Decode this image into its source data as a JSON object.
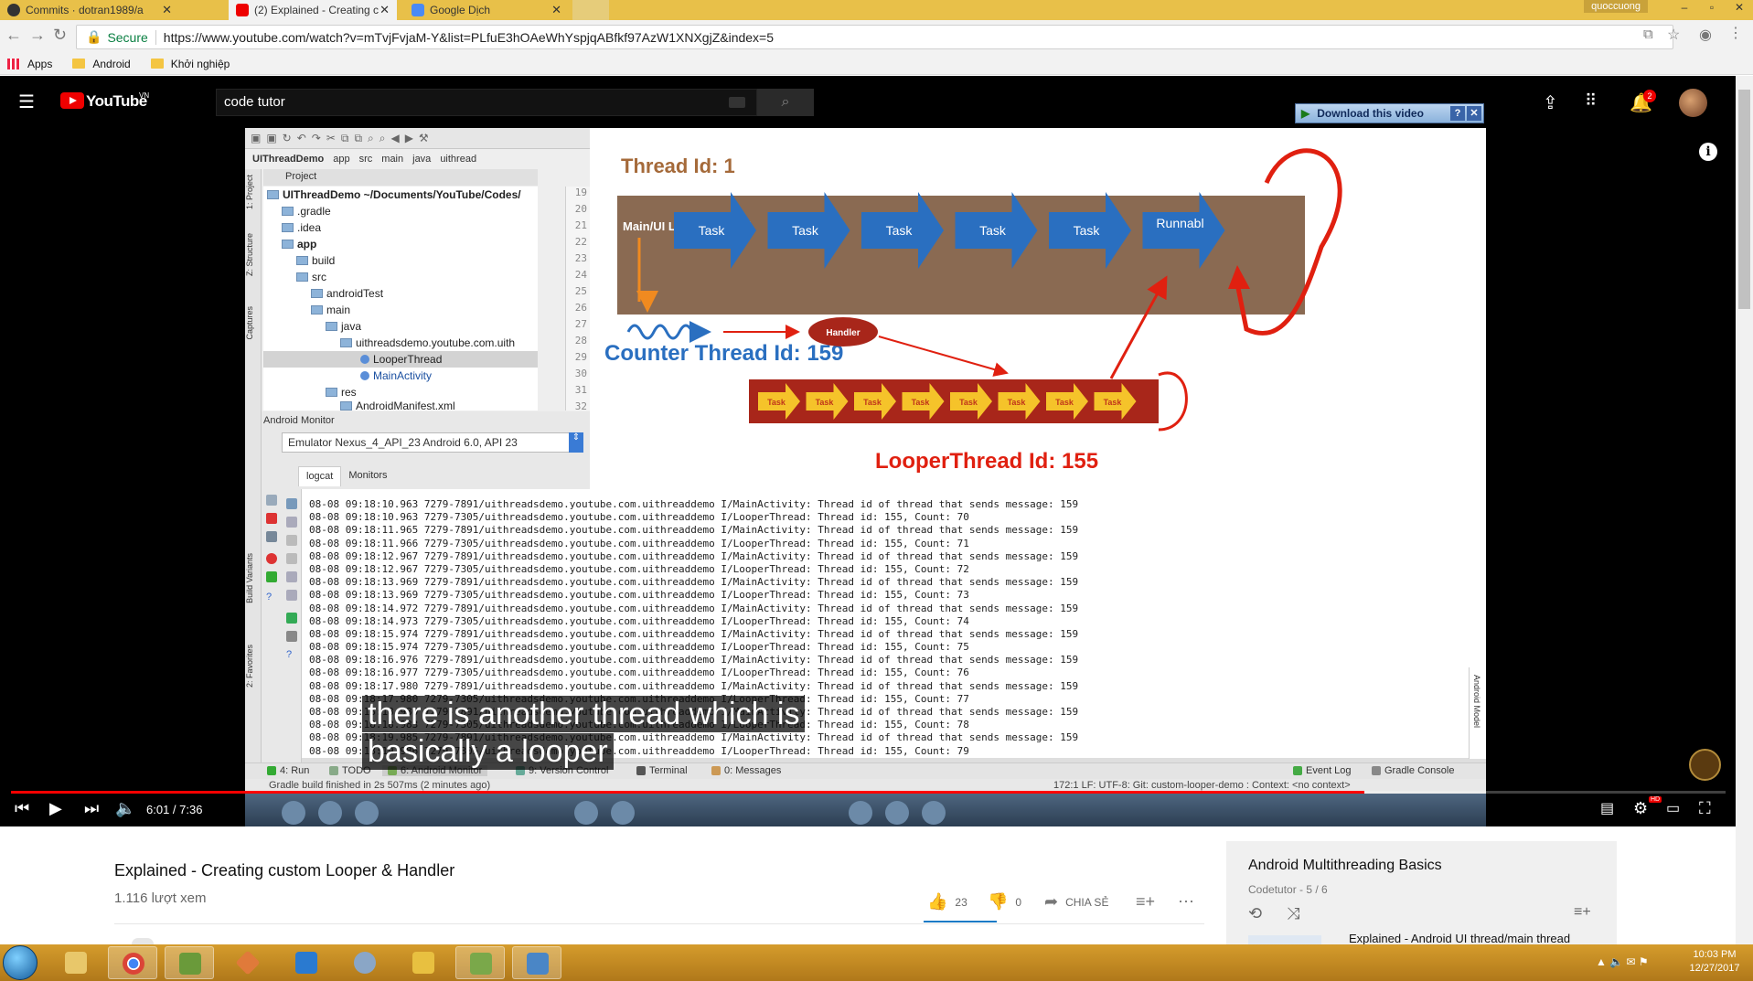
{
  "browser": {
    "tabs": [
      {
        "label": "Commits · dotran1989/a"
      },
      {
        "label": "(2) Explained - Creating c"
      },
      {
        "label": "Google Dịch"
      }
    ],
    "user": "quoccuong",
    "secure_label": "Secure",
    "url": "https://www.youtube.com/watch?v=mTvjFvjaM-Y&list=PLfuE3hOAeWhYspjqABfkf97AzW1XNXgjZ&index=5",
    "bookmarks": [
      "Apps",
      "Android",
      "Khởi nghiệp"
    ]
  },
  "youtube": {
    "logo": "YouTube",
    "region": "VN",
    "search_value": "code tutor",
    "notifications": "2",
    "download_bar": "Download this video"
  },
  "ide": {
    "crumbs": [
      "UIThreadDemo",
      "app",
      "src",
      "main",
      "java",
      "uithread"
    ],
    "project_label": "Project",
    "tree": [
      {
        "label": "UIThreadDemo ~/Documents/YouTube/Codes/",
        "indent": 0
      },
      {
        "label": ".gradle",
        "indent": 1
      },
      {
        "label": ".idea",
        "indent": 1
      },
      {
        "label": "app",
        "indent": 1
      },
      {
        "label": "build",
        "indent": 2
      },
      {
        "label": "src",
        "indent": 2
      },
      {
        "label": "androidTest",
        "indent": 3
      },
      {
        "label": "main",
        "indent": 3
      },
      {
        "label": "java",
        "indent": 4
      },
      {
        "label": "uithreadsdemo.youtube.com.uith",
        "indent": 5
      },
      {
        "label": "LooperThread",
        "indent": 6
      },
      {
        "label": "MainActivity",
        "indent": 6
      },
      {
        "label": "res",
        "indent": 4
      },
      {
        "label": "AndroidManifest.xml",
        "indent": 4
      }
    ],
    "line_numbers": [
      "19",
      "20",
      "21",
      "22",
      "23",
      "24",
      "25",
      "26",
      "27",
      "28",
      "29",
      "30",
      "31",
      "32"
    ],
    "monitor_title": "Android Monitor",
    "emulator": "Emulator Nexus_4_API_23 Android 6.0, API 23",
    "logcat_tab": "logcat",
    "monitors_tab": "Monitors",
    "side_tabs": [
      "1: Project",
      "Z: Structure",
      "Captures",
      "Build Variants",
      "2: Favorites"
    ],
    "right_tab": "Android Model",
    "bottom_tabs": [
      "4: Run",
      "TODO",
      "6: Android Monitor",
      "9: Version Control",
      "Terminal",
      "0: Messages",
      "Event Log",
      "Gradle Console"
    ],
    "status": "Gradle build finished in 2s 507ms (2 minutes ago)",
    "status_right": "172:1   LF:   UTF-8:   Git: custom-looper-demo :   Context: <no context>",
    "log_lines": [
      "08-08 09:18:10.963 7279-7891/uithreadsdemo.youtube.com.uithreaddemo I/MainActivity: Thread id of thread that sends message: 159",
      "08-08 09:18:10.963 7279-7305/uithreadsdemo.youtube.com.uithreaddemo I/LooperThread: Thread id: 155, Count: 70",
      "08-08 09:18:11.965 7279-7891/uithreadsdemo.youtube.com.uithreaddemo I/MainActivity: Thread id of thread that sends message: 159",
      "08-08 09:18:11.966 7279-7305/uithreadsdemo.youtube.com.uithreaddemo I/LooperThread: Thread id: 155, Count: 71",
      "08-08 09:18:12.967 7279-7891/uithreadsdemo.youtube.com.uithreaddemo I/MainActivity: Thread id of thread that sends message: 159",
      "08-08 09:18:12.967 7279-7305/uithreadsdemo.youtube.com.uithreaddemo I/LooperThread: Thread id: 155, Count: 72",
      "08-08 09:18:13.969 7279-7891/uithreadsdemo.youtube.com.uithreaddemo I/MainActivity: Thread id of thread that sends message: 159",
      "08-08 09:18:13.969 7279-7305/uithreadsdemo.youtube.com.uithreaddemo I/LooperThread: Thread id: 155, Count: 73",
      "08-08 09:18:14.972 7279-7891/uithreadsdemo.youtube.com.uithreaddemo I/MainActivity: Thread id of thread that sends message: 159",
      "08-08 09:18:14.973 7279-7305/uithreadsdemo.youtube.com.uithreaddemo I/LooperThread: Thread id: 155, Count: 74",
      "08-08 09:18:15.974 7279-7891/uithreadsdemo.youtube.com.uithreaddemo I/MainActivity: Thread id of thread that sends message: 159",
      "08-08 09:18:15.974 7279-7305/uithreadsdemo.youtube.com.uithreaddemo I/LooperThread: Thread id: 155, Count: 75",
      "08-08 09:18:16.976 7279-7891/uithreadsdemo.youtube.com.uithreaddemo I/MainActivity: Thread id of thread that sends message: 159",
      "08-08 09:18:16.977 7279-7305/uithreadsdemo.youtube.com.uithreaddemo I/LooperThread: Thread id: 155, Count: 76",
      "08-08 09:18:17.980 7279-7891/uithreadsdemo.youtube.com.uithreaddemo I/MainActivity: Thread id of thread that sends message: 159",
      "08-08 09:18:17.980 7279-7305/uithreadsdemo.youtube.com.uithreaddemo I/LooperThread: Thread id: 155, Count: 77",
      "08-08 09:18:18.980 7279-7891/uithreadsdemo.youtube.com.uithreaddemo I/MainActivity: Thread id of thread that sends message: 159",
      "08-08 09:18:18.983 7279-7305/uithreadsdemo.youtube.com.uithreaddemo I/LooperThread: Thread id: 155, Count: 78",
      "08-08 09:18:19.985 7279-7891/uithreadsdemo.youtube.com.uithreaddemo I/MainActivity: Thread id of thread that sends message: 159",
      "08-08 09:18:19.986 7279-7305/uithreadsdemo.youtube.com.uithreaddemo I/LooperThread: Thread id: 155, Count: 79"
    ]
  },
  "slide": {
    "thread_title": "Thread Id: 1",
    "main_label": "Main/UI Looper Thread",
    "tasks": [
      "Task",
      "Task",
      "Task",
      "Task",
      "Task",
      "Runnabl"
    ],
    "counter_label": "Counter Thread Id: 159",
    "handler": "Handler",
    "small_tasks": [
      "Task",
      "Task",
      "Task",
      "Task",
      "Task",
      "Task",
      "Task",
      "Task"
    ],
    "looper_label": "LooperThread Id: 155",
    "colors": {
      "brown": "#8a6a52",
      "red_bar": "#a8261a",
      "blue": "#2a6fc0",
      "arrow_red": "#e02010",
      "title_brown": "#a56a3a"
    }
  },
  "player": {
    "caption": [
      "there is another thread which is",
      "basically a looper"
    ],
    "time": "6:01 / 7:36",
    "progress": 0.7895
  },
  "video": {
    "title": "Explained - Creating custom Looper & Handler",
    "views": "1.116 lượt xem",
    "likes": "23",
    "dislikes": "0",
    "share": "CHIA SẺ"
  },
  "playlist": {
    "title": "Android Multithreading Basics",
    "sub": "Codetutor - 5 / 6",
    "next": "Explained - Android UI thread/main thread"
  },
  "taskbar": {
    "time": "10:03 PM",
    "date": "12/27/2017"
  }
}
